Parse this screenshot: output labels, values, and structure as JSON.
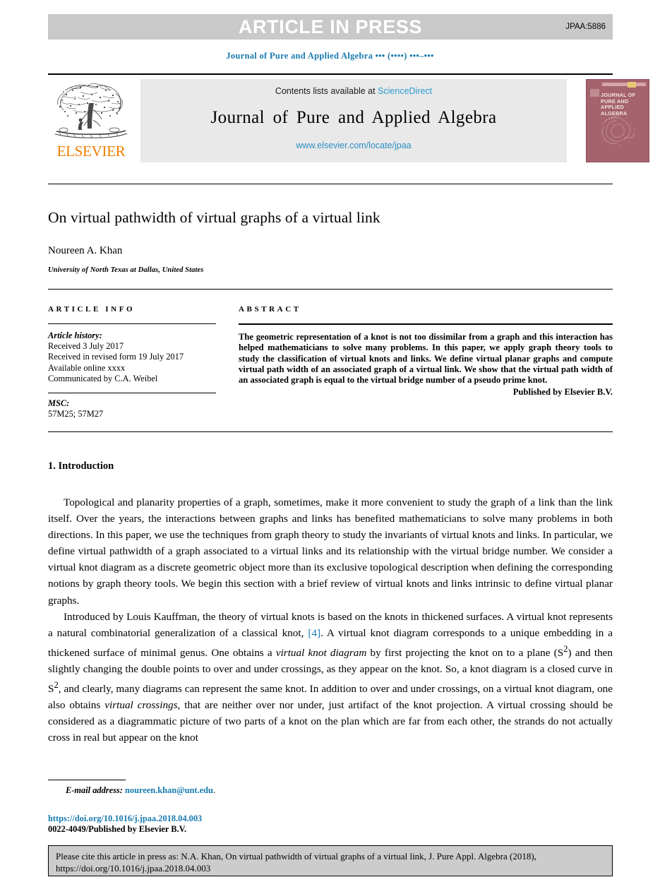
{
  "banner": {
    "text": "ARTICLE IN PRESS",
    "code": "JPAA:5886",
    "band_color": "#c9c9c9"
  },
  "running_head": "Journal of Pure and Applied Algebra ••• (••••) •••–•••",
  "masthead": {
    "publisher_logo_word": "ELSEVIER",
    "publisher_color": "#ef7d00",
    "contents_prefix": "Contents lists available at ",
    "contents_link": "ScienceDirect",
    "journal_name": "Journal of Pure and Applied Algebra",
    "journal_url": "www.elsevier.com/locate/jpaa",
    "link_color": "#2b9bd4",
    "cover": {
      "title": "JOURNAL OF PURE AND APPLIED ALGEBRA",
      "background": "#a5636d"
    }
  },
  "article": {
    "title": "On virtual pathwidth of virtual graphs of a virtual link",
    "author": "Noureen A. Khan",
    "affiliation": "University of North Texas at Dallas, United States"
  },
  "info": {
    "label": "ARTICLE INFO",
    "history_title": "Article history:",
    "history_lines": [
      "Received 3 July 2017",
      "Received in revised form 19 July 2017",
      "Available online xxxx",
      "Communicated by C.A. Weibel"
    ],
    "msc_title": "MSC:",
    "msc_value": "57M25; 57M27"
  },
  "abstract": {
    "label": "ABSTRACT",
    "text": "The geometric representation of a knot is not too dissimilar from a graph and this interaction has helped mathematicians to solve many problems. In this paper, we apply graph theory tools to study the classification of virtual knots and links. We define virtual planar graphs and compute virtual path width of an associated graph of a virtual link. We show that the virtual path width of an associated graph is equal to the virtual bridge number of a pseudo prime knot.",
    "publisher_line": "Published by Elsevier B.V."
  },
  "body": {
    "section_heading": "1. Introduction",
    "paragraph_1": "Topological and planarity properties of a graph, sometimes, make it more convenient to study the graph of a link than the link itself. Over the years, the interactions between graphs and links has benefited mathematicians to solve many problems in both directions. In this paper, we use the techniques from graph theory to study the invariants of virtual knots and links. In particular, we define virtual pathwidth of a graph associated to a virtual links and its relationship with the virtual bridge number. We consider a virtual knot diagram as a discrete geometric object more than its exclusive topological description when defining the corresponding notions by graph theory tools. We begin this section with a brief review of virtual knots and links intrinsic to define virtual planar graphs.",
    "paragraph_2_a": "Introduced by Louis Kauffman, the theory of virtual knots is based on the knots in thickened surfaces. A virtual knot represents a natural combinatorial generalization of a classical knot, ",
    "paragraph_2_citation": "[4]",
    "paragraph_2_b": ". A virtual knot diagram corresponds to a unique embedding in a thickened surface of minimal genus. One obtains a ",
    "paragraph_2_italic_1": "virtual knot diagram",
    "paragraph_2_c": " by first projecting the knot on to a plane (S",
    "paragraph_2_d": ") and then slightly changing the double points to over and under crossings, as they appear on the knot. So, a knot diagram is a closed curve in S",
    "paragraph_2_e": ", and clearly, many diagrams can represent the same knot. In addition to over and under crossings, on a virtual knot diagram, one also obtains ",
    "paragraph_2_italic_2": "virtual crossings",
    "paragraph_2_f": ", that are neither over nor under, just artifact of the knot projection. A virtual crossing should be considered as a diagrammatic picture of two parts of a knot on the plan which are far from each other, the strands do not actually cross in real but appear on the knot",
    "superscript": "2"
  },
  "footer": {
    "email_label": "E-mail address:",
    "email_address": "noureen.khan@unt.edu",
    "email_period": ".",
    "doi": "https://doi.org/10.1016/j.jpaa.2018.04.003",
    "issn_line": "0022-4049/Published by Elsevier B.V."
  },
  "citation_box": {
    "text": "Please cite this article in press as: N.A. Khan, On virtual pathwidth of virtual graphs of a virtual link, J. Pure Appl. Algebra (2018), https://doi.org/10.1016/j.jpaa.2018.04.003",
    "background": "#cccccc"
  }
}
